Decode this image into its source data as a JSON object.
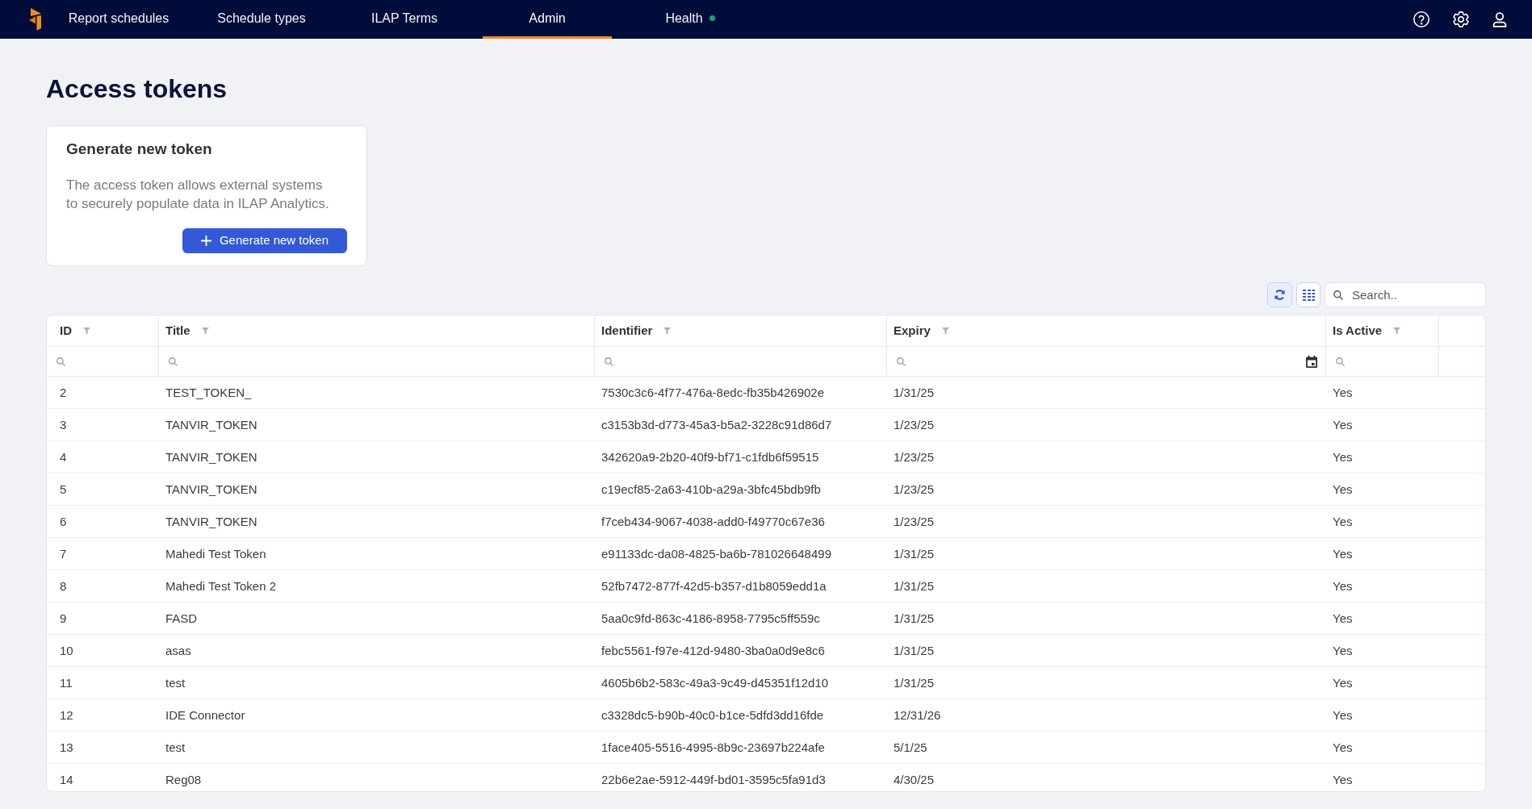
{
  "nav": {
    "items": [
      {
        "label": "Report schedules",
        "selected": false
      },
      {
        "label": "Schedule types",
        "selected": false
      },
      {
        "label": "ILAP Terms",
        "selected": false
      },
      {
        "label": "Admin",
        "selected": true
      },
      {
        "label": "Health",
        "selected": false,
        "color": "#12a57c"
      }
    ]
  },
  "title": "Access tokens",
  "generate_card": {
    "title": "Generate new token",
    "description": "The access token allows external systems to securely populate data in ILAP Analytics.",
    "button": "Generate new token"
  },
  "toolbar": {
    "search": {
      "placeholder": "Search.."
    }
  },
  "table": {
    "columns": [
      {
        "label": "ID",
        "kind": "text"
      },
      {
        "label": "Title",
        "kind": "text"
      },
      {
        "label": "Identifier",
        "kind": "text"
      },
      {
        "label": "Expiry",
        "kind": "date"
      },
      {
        "label": "Is Active",
        "kind": "text"
      }
    ],
    "rows": [
      [
        "2",
        "TEST_TOKEN_",
        "7530c3c6-4f77-476a-8edc-fb35b426902e",
        "1/31/25",
        "Yes"
      ],
      [
        "3",
        "TANVIR_TOKEN",
        "c3153b3d-d773-45a3-b5a2-3228c91d86d7",
        "1/23/25",
        "Yes"
      ],
      [
        "4",
        "TANVIR_TOKEN",
        "342620a9-2b20-40f9-bf71-c1fdb6f59515",
        "1/23/25",
        "Yes"
      ],
      [
        "5",
        "TANVIR_TOKEN",
        "c19ecf85-2a63-410b-a29a-3bfc45bdb9fb",
        "1/23/25",
        "Yes"
      ],
      [
        "6",
        "TANVIR_TOKEN",
        "f7ceb434-9067-4038-add0-f49770c67e36",
        "1/23/25",
        "Yes"
      ],
      [
        "7",
        "Mahedi Test Token",
        "e91133dc-da08-4825-ba6b-781026648499",
        "1/31/25",
        "Yes"
      ],
      [
        "8",
        "Mahedi Test Token 2",
        "52fb7472-877f-42d5-b357-d1b8059edd1a",
        "1/31/25",
        "Yes"
      ],
      [
        "9",
        "FASD",
        "5aa0c9fd-863c-4186-8958-7795c5ff559c",
        "1/31/25",
        "Yes"
      ],
      [
        "10",
        "asas",
        "febc5561-f97e-412d-9480-3ba0a0d9e8c6",
        "1/31/25",
        "Yes"
      ],
      [
        "11",
        "test",
        "4605b6b2-583c-49a3-9c49-d45351f12d10",
        "1/31/25",
        "Yes"
      ],
      [
        "12",
        "IDE Connector",
        "c3328dc5-b90b-40c0-b1ce-5dfd3dd16fde",
        "12/31/26",
        "Yes"
      ],
      [
        "13",
        "test",
        "1face405-5516-4995-8b9c-23697b224afe",
        "5/1/25",
        "Yes"
      ],
      [
        "14",
        "Reg08",
        "22b6e2ae-5912-449f-bd01-3595c5fa91d3",
        "4/30/25",
        "Yes"
      ]
    ]
  }
}
